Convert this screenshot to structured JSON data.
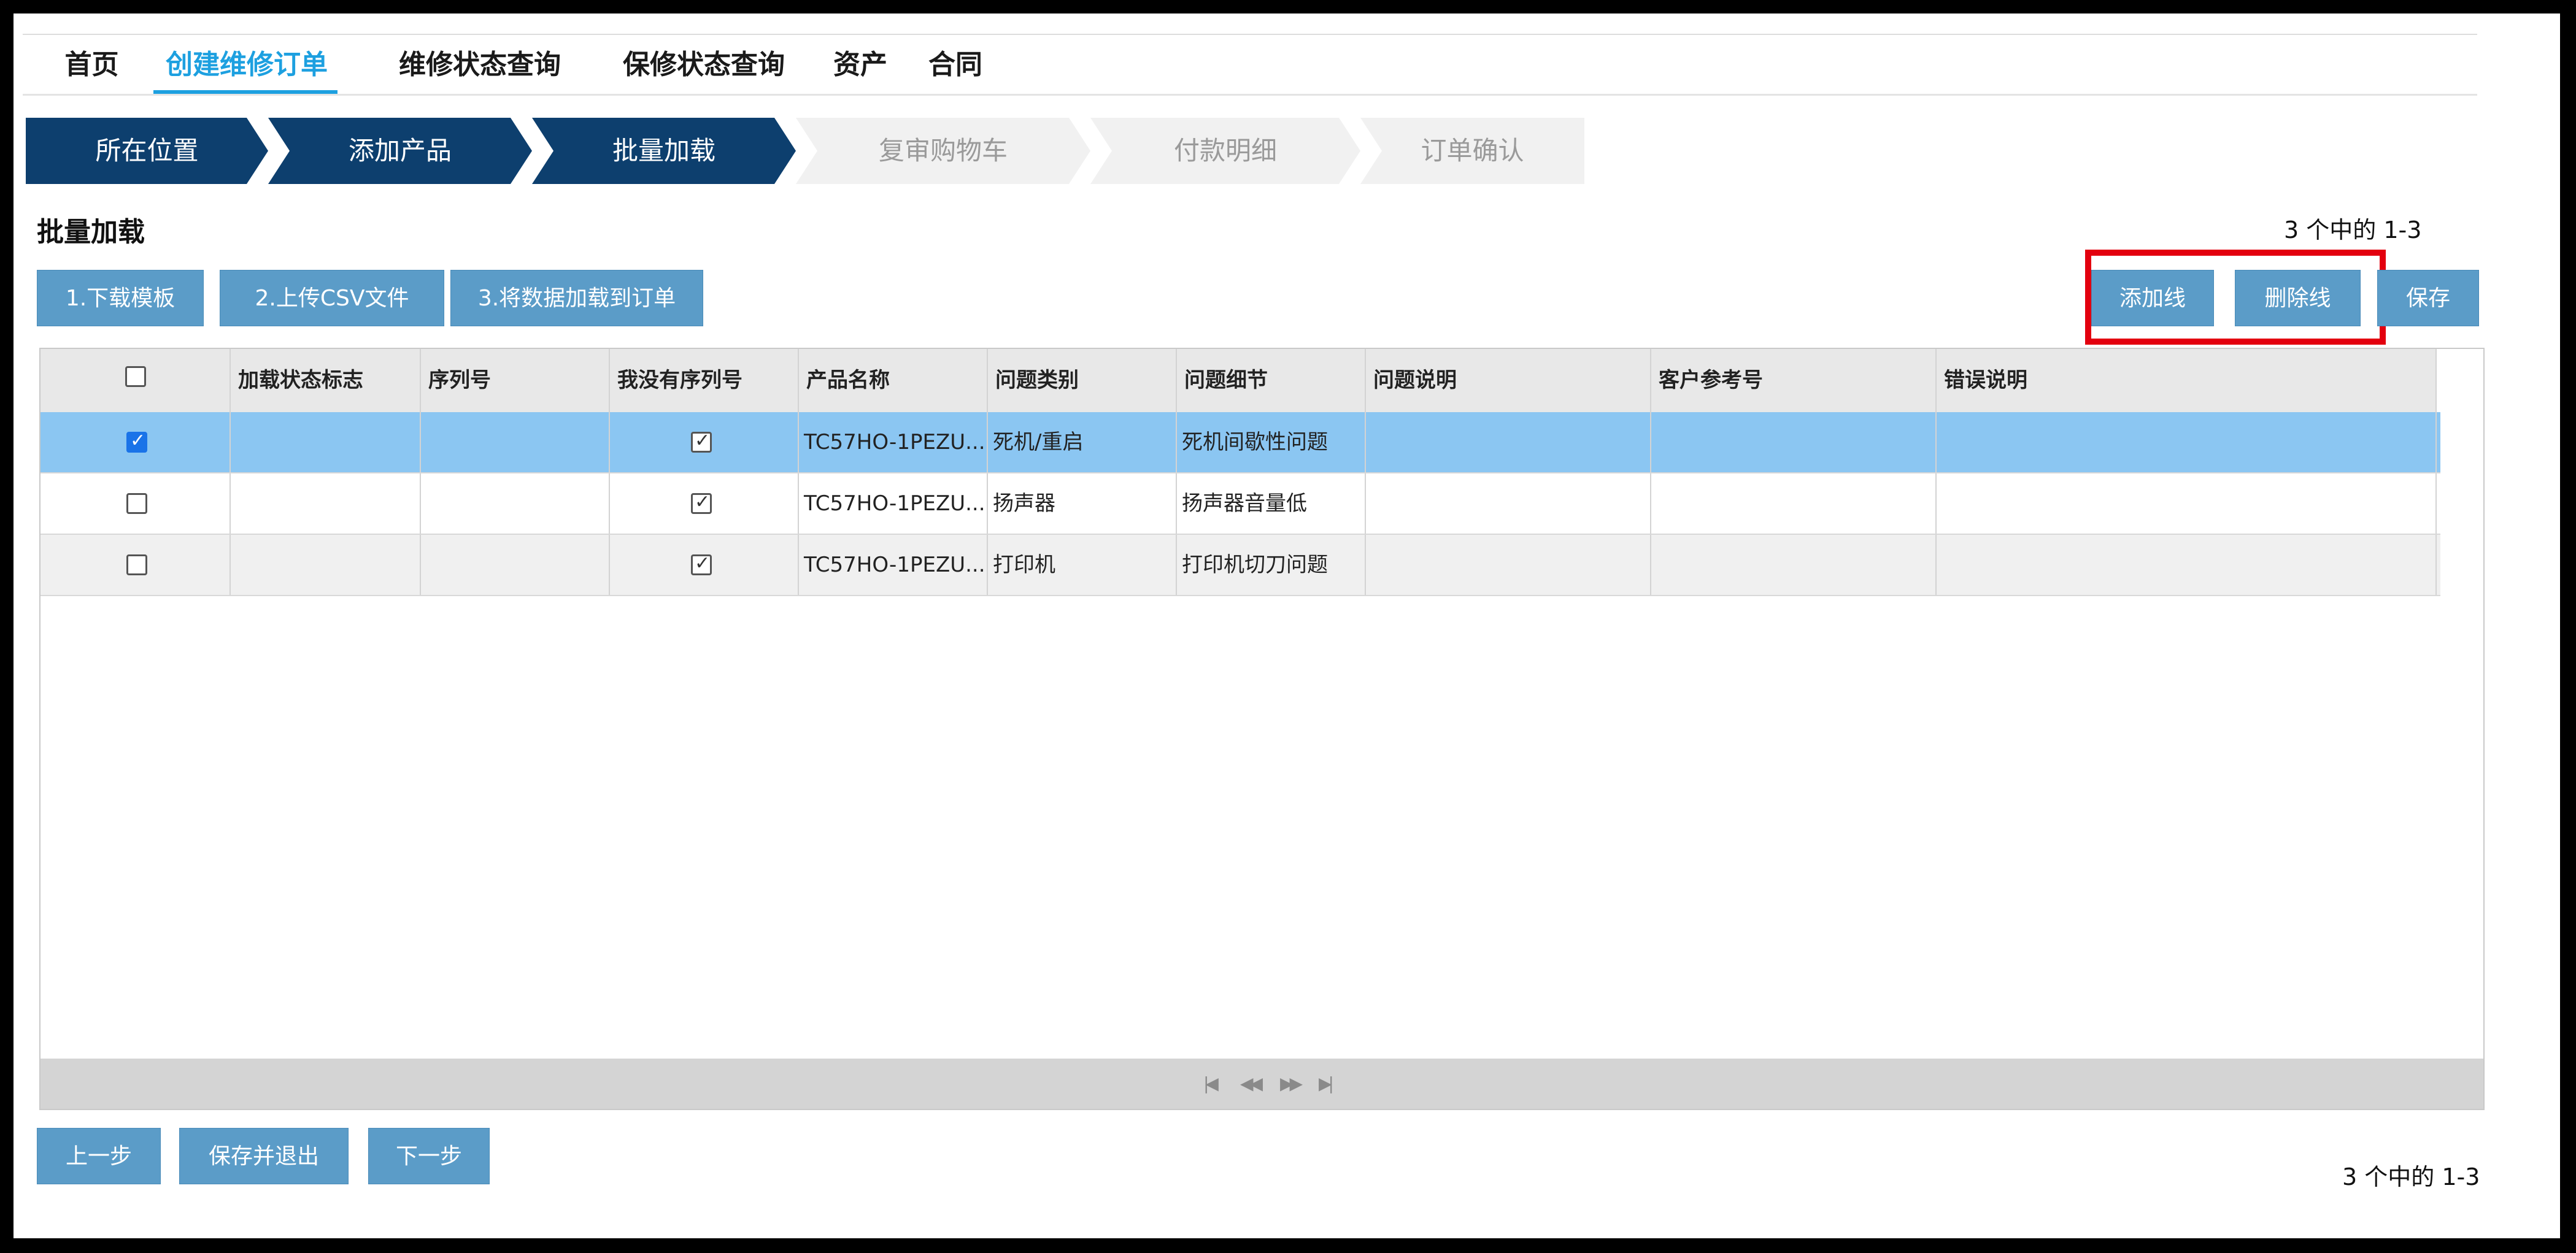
{
  "nav": {
    "items": [
      "首页",
      "创建维修订单",
      "维修状态查询",
      "保修状态查询",
      "资产",
      "合同"
    ]
  },
  "steps": [
    "所在位置",
    "添加产品",
    "批量加载",
    "复审购物车",
    "付款明细",
    "订单确认"
  ],
  "section": {
    "title": "批量加载",
    "count": "3 个中的 1-3"
  },
  "actions": {
    "download": "1.下载模板",
    "upload": "2.上传CSV文件",
    "load": "3.将数据加载到订单",
    "add_line": "添加线",
    "delete_line": "删除线",
    "save": "保存"
  },
  "table": {
    "headers": [
      "加载状态标志",
      "序列号",
      "我没有序列号",
      "产品名称",
      "问题类别",
      "问题细节",
      "问题说明",
      "客户参考号",
      "错误说明"
    ],
    "rows": [
      {
        "selected": true,
        "status": "",
        "serial": "",
        "no_serial": true,
        "product": "TC57HO-1PEZU...",
        "category": "死机/重启",
        "detail": "死机间歇性问题",
        "desc": "",
        "ref": "",
        "error": ""
      },
      {
        "selected": false,
        "status": "",
        "serial": "",
        "no_serial": true,
        "product": "TC57HO-1PEZU...",
        "category": "扬声器",
        "detail": "扬声器音量低",
        "desc": "",
        "ref": "",
        "error": ""
      },
      {
        "selected": false,
        "status": "",
        "serial": "",
        "no_serial": true,
        "product": "TC57HO-1PEZU...",
        "category": "打印机",
        "detail": "打印机切刀问题",
        "desc": "",
        "ref": "",
        "error": ""
      }
    ]
  },
  "pager": {
    "first": "|◀",
    "prev": "◀◀",
    "next": "▶▶",
    "last": "▶|"
  },
  "footer": {
    "prev": "上一步",
    "save_exit": "保存并退出",
    "next": "下一步",
    "count": "3 个中的 1-3"
  },
  "colors": {
    "accent": "#1da0e0",
    "button": "#5b9cc8",
    "step_done": "#0d3f6e",
    "step_todo": "#f1f1f1",
    "row_selected": "#8bc6f2",
    "highlight": "#e3000f"
  }
}
